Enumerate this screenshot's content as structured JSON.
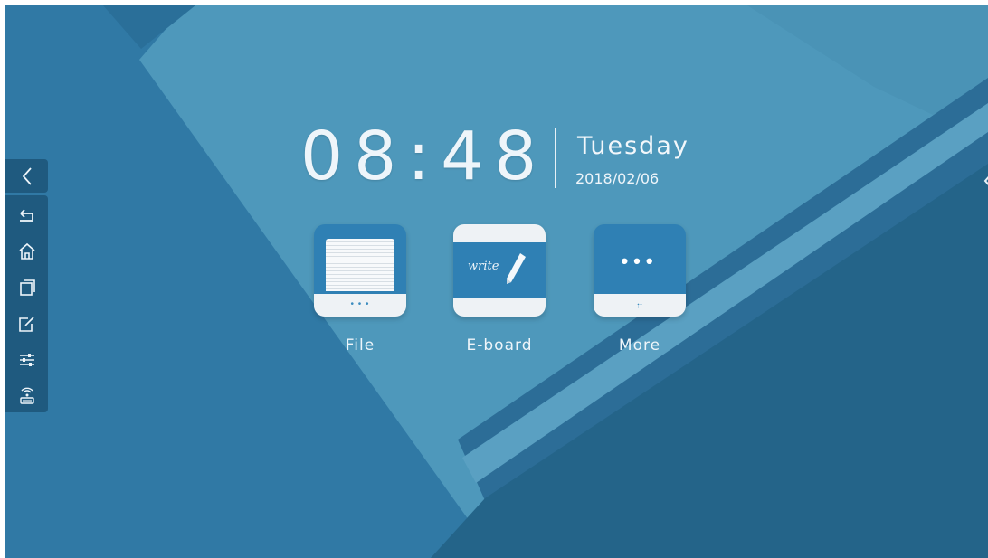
{
  "clock": {
    "time": "08:48",
    "weekday": "Tuesday",
    "date": "2018/02/06"
  },
  "apps": [
    {
      "label": "File",
      "icon": "file-icon"
    },
    {
      "label": "E-board",
      "icon": "eboard-icon",
      "tile_text": "write"
    },
    {
      "label": "More",
      "icon": "more-icon"
    }
  ],
  "sidebar": {
    "toggle_icon": "chevron-left-icon",
    "items": [
      {
        "icon": "back-icon"
      },
      {
        "icon": "home-icon"
      },
      {
        "icon": "multitask-icon"
      },
      {
        "icon": "annotate-icon"
      },
      {
        "icon": "settings-sliders-icon"
      },
      {
        "icon": "wireless-display-icon"
      }
    ]
  },
  "edge_handle": {
    "icon": "chevron-left-icon"
  },
  "colors": {
    "background": "#2f7aa5",
    "sidebar": "#1f5a7f",
    "tile_accent": "#2f80b4",
    "tile_light": "#eef2f5"
  }
}
